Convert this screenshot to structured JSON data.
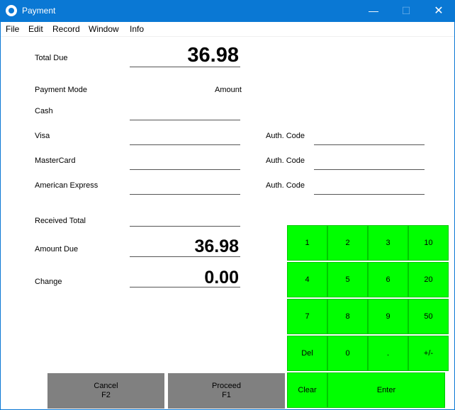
{
  "window": {
    "title": "Payment",
    "minimize_glyph": "—",
    "maximize_glyph": "☐",
    "close_glyph": "✕"
  },
  "menu": [
    "File",
    "Edit",
    "Record",
    "Window",
    "Info"
  ],
  "form": {
    "total_due_label": "Total Due",
    "total_due_value": "36.98",
    "payment_mode_label": "Payment Mode",
    "amount_label": "Amount",
    "cash_label": "Cash",
    "visa_label": "Visa",
    "mastercard_label": "MasterCard",
    "amex_label": "American Express",
    "auth_code_label": "Auth. Code",
    "received_total_label": "Received Total",
    "amount_due_label": "Amount Due",
    "amount_due_value": "36.98",
    "change_label": "Change",
    "change_value": "0.00"
  },
  "keypad": {
    "row1": [
      "1",
      "2",
      "3",
      "10"
    ],
    "row2": [
      "4",
      "5",
      "6",
      "20"
    ],
    "row3": [
      "7",
      "8",
      "9",
      "50"
    ],
    "row4": [
      "Del",
      "0",
      ".",
      "+/-"
    ],
    "clear": "Clear",
    "enter": "Enter"
  },
  "buttons": {
    "cancel_label": "Cancel",
    "cancel_key": "F2",
    "proceed_label": "Proceed",
    "proceed_key": "F1"
  },
  "colors": {
    "titlebar": "#0a78d4",
    "keypad": "#00ff00",
    "action_button": "#808080"
  },
  "icons": {
    "app": "app-logo-icon"
  }
}
